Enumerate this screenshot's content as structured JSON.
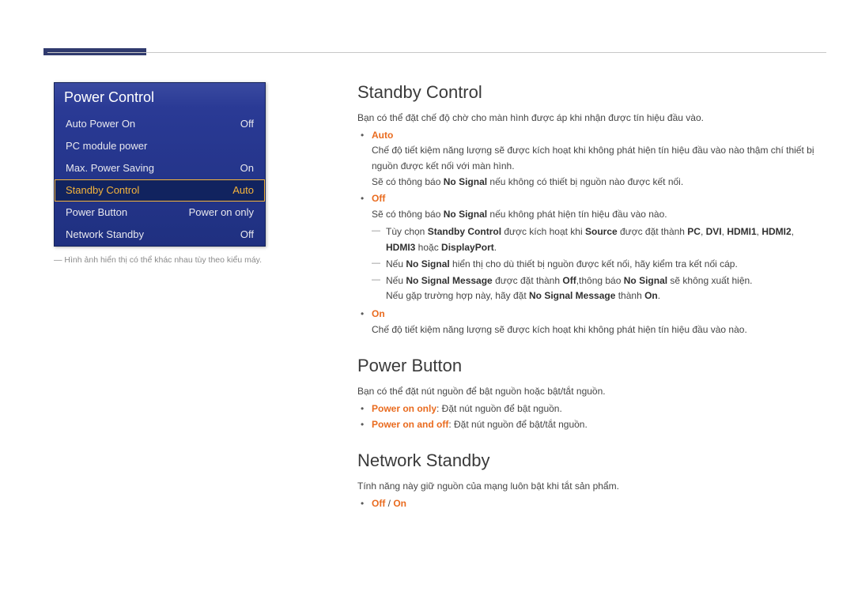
{
  "osd": {
    "title": "Power Control",
    "items": [
      {
        "label": "Auto Power On",
        "value": "Off",
        "selected": false
      },
      {
        "label": "PC module power",
        "value": "",
        "selected": false
      },
      {
        "label": "Max. Power Saving",
        "value": "On",
        "selected": false
      },
      {
        "label": "Standby Control",
        "value": "Auto",
        "selected": true
      },
      {
        "label": "Power Button",
        "value": "Power on only",
        "selected": false
      },
      {
        "label": "Network Standby",
        "value": "Off",
        "selected": false
      }
    ],
    "footnote": "― Hình ảnh hiển thị có thể khác nhau tùy theo kiểu máy."
  },
  "sections": {
    "standby": {
      "title": "Standby Control",
      "desc": "Bạn có thể đặt chế độ chờ cho màn hình được áp khi nhận được tín hiệu đầu vào.",
      "auto_label": "Auto",
      "auto_line1": "Chế độ tiết kiệm năng lượng sẽ được kích hoạt khi không phát hiện tín hiệu đầu vào nào thậm chí thiết bị nguồn được kết nối với màn hình.",
      "auto_line2_pre": "Sẽ có thông báo ",
      "auto_line2_bold": "No Signal",
      "auto_line2_post": " nếu không có thiết bị nguồn nào được kết nối.",
      "off_label": "Off",
      "off_line_pre": "Sẽ có thông báo ",
      "off_line_bold": "No Signal",
      "off_line_post": " nếu không phát hiện tín hiệu đầu vào nào.",
      "sub1_pre": "Tùy chọn ",
      "sub1_b1": "Standby Control",
      "sub1_mid1": " được kích hoạt khi ",
      "sub1_b2": "Source",
      "sub1_mid2": " được đặt thành ",
      "sub1_b3": "PC",
      "sub1_b4": "DVI",
      "sub1_b5": "HDMI1",
      "sub1_b6": "HDMI2",
      "sub1_b7": "HDMI3",
      "sub1_or": " hoặc ",
      "sub1_b8": "DisplayPort",
      "sub2_pre": "Nếu ",
      "sub2_b1": "No Signal",
      "sub2_post": " hiển thị cho dù thiết bị nguồn được kết nối, hãy kiểm tra kết nối cáp.",
      "sub3_pre": "Nếu ",
      "sub3_b1": "No Signal Message",
      "sub3_mid1": " được đặt thành ",
      "sub3_b2": "Off",
      "sub3_mid2": ",thông báo ",
      "sub3_b3": "No Signal",
      "sub3_post": " sẽ không xuất hiện.",
      "sub3_line4_pre": "Nếu gặp trường hợp này, hãy đặt ",
      "sub3_line4_b1": "No Signal Message",
      "sub3_line4_mid": " thành ",
      "sub3_line4_b2": "On",
      "on_label": "On",
      "on_line": "Chế độ tiết kiệm năng lượng sẽ được kích hoạt khi không phát hiện tín hiệu đầu vào nào."
    },
    "powerbtn": {
      "title": "Power Button",
      "desc": "Bạn có thể đặt nút nguồn để bật nguồn hoặc bật/tắt nguồn.",
      "opt1_label": "Power on only",
      "opt1_text": ": Đặt nút nguồn để bật nguồn.",
      "opt2_label": "Power on and off",
      "opt2_text": ": Đặt nút nguồn để bật/tắt nguồn."
    },
    "netstandby": {
      "title": "Network Standby",
      "desc": "Tính năng này giữ nguồn của mạng luôn bật khi tắt sản phẩm.",
      "opt_off": "Off",
      "opt_slash": " / ",
      "opt_on": "On"
    }
  }
}
